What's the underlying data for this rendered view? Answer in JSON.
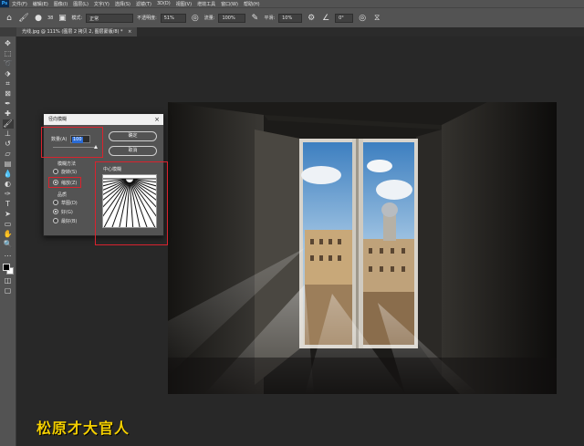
{
  "app": {
    "logo": "Ps"
  },
  "menu": [
    "文件(F)",
    "编辑(E)",
    "图像(I)",
    "图层(L)",
    "文字(Y)",
    "选择(S)",
    "滤镜(T)",
    "3D(D)",
    "视图(V)",
    "增效工具",
    "窗口(W)",
    "帮助(H)"
  ],
  "options": {
    "brush_size": "38",
    "mode_label": "模式:",
    "mode_value": "正常",
    "opacity_label": "不透明度:",
    "opacity_value": "51%",
    "flow_label": "流量:",
    "flow_value": "100%",
    "smooth_label": "平滑:",
    "smooth_value": "10%",
    "angle_value": "0°"
  },
  "document": {
    "tab_title": "光线.jpg @ 111% (图层 2 拷贝 2, 图层蒙版/8) *",
    "close": "×"
  },
  "dialog": {
    "title": "径向模糊",
    "close": "×",
    "amount_label": "数量(A)",
    "amount_value": "100",
    "ok_label": "确定",
    "cancel_label": "取消",
    "method_label": "模糊方法",
    "method_spin": "旋转(S)",
    "method_zoom": "缩放(Z)",
    "method_selected": "zoom",
    "quality_label": "品质",
    "quality_draft": "草图(D)",
    "quality_good": "好(G)",
    "quality_best": "最好(B)",
    "quality_selected": "good",
    "center_label": "中心模糊"
  },
  "watermark": "松原才大官人",
  "colors": {
    "accent_red": "#d9232e",
    "watermark": "#f5d000",
    "selection_blue": "#2b6cd6"
  }
}
